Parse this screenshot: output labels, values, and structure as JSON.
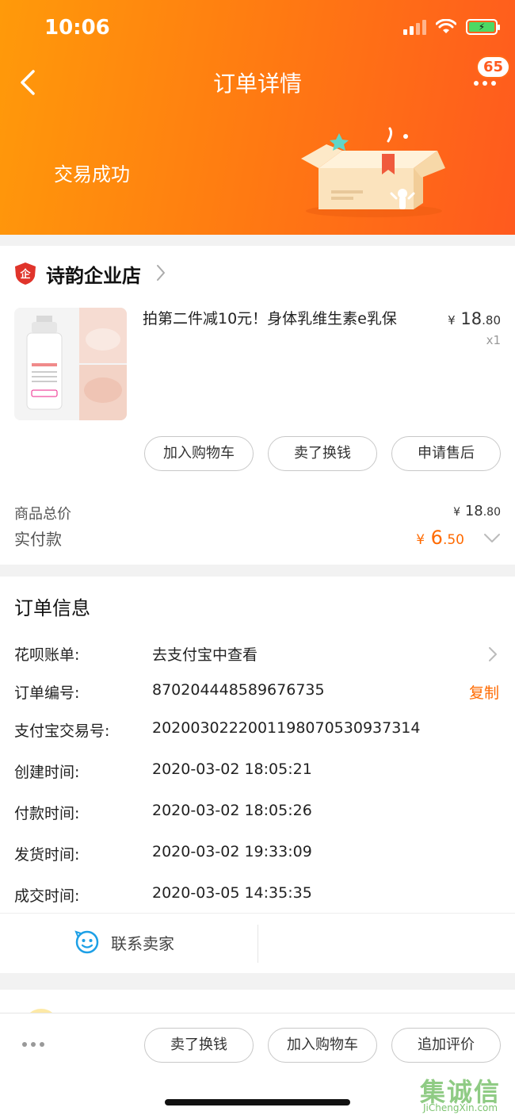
{
  "status_bar": {
    "time": "10:06"
  },
  "header": {
    "title": "订单详情",
    "badge_count": "65",
    "trade_status": "交易成功",
    "accent": "#ff6a12"
  },
  "shop": {
    "name": "诗韵企业店",
    "logo_icon": "enterprise-shield-icon",
    "product": {
      "title": "拍第二件减10元！身体乳维生素e乳保",
      "price_yen": "¥",
      "price_int": "18",
      "price_dec": ".80",
      "qty": "x1"
    },
    "actions": [
      "加入购物车",
      "卖了换钱",
      "申请售后"
    ],
    "summary": {
      "total_label": "商品总价",
      "total_yen": "¥",
      "total_int": "18",
      "total_dec": ".80",
      "paid_label": "实付款",
      "paid_yen": "¥",
      "paid_int": "6",
      "paid_dec": ".50"
    }
  },
  "order_info": {
    "heading": "订单信息",
    "rows": [
      {
        "label": "花呗账单:",
        "value": "去支付宝中查看"
      },
      {
        "label": "订单编号:",
        "value": "870204448589676735",
        "action": "复制"
      },
      {
        "label": "支付宝交易号:",
        "value": "2020030222001198070530937314"
      },
      {
        "label": "创建时间:",
        "value": "2020-03-02 18:05:21"
      },
      {
        "label": "付款时间:",
        "value": "2020-03-02 18:05:26"
      },
      {
        "label": "发货时间:",
        "value": "2020-03-02 19:33:09"
      },
      {
        "label": "成交时间:",
        "value": "2020-03-05 14:35:35"
      }
    ],
    "contact_label": "联系卖家"
  },
  "bottom_bar": {
    "actions": [
      "卖了换钱",
      "加入购物车",
      "追加评价"
    ]
  },
  "watermark": {
    "text": "集诚信",
    "sub": "JiChengXin.com"
  }
}
